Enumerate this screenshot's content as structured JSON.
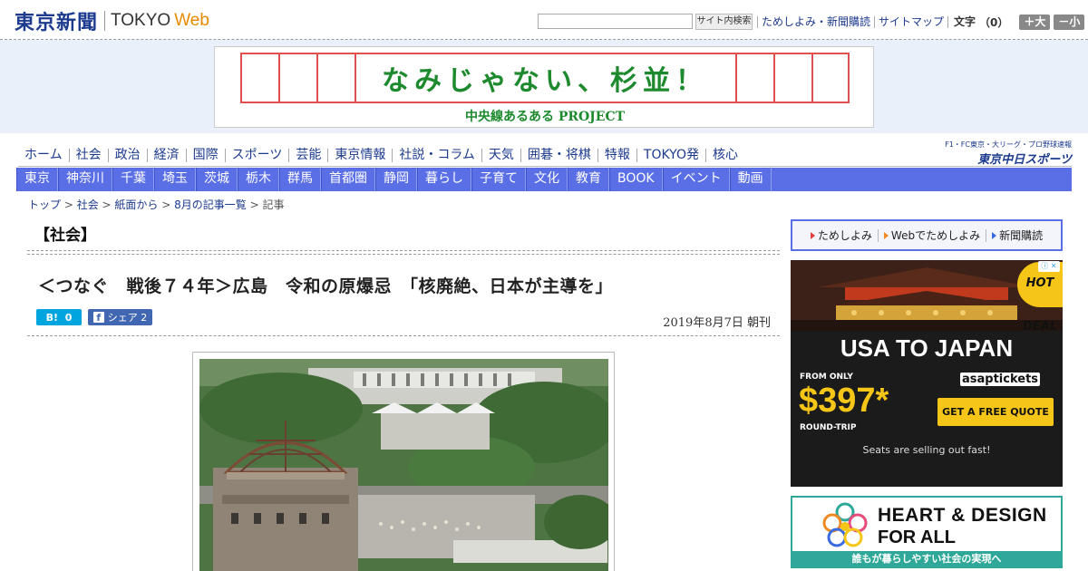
{
  "header": {
    "logo_jp": "東京新聞",
    "logo_en": "TOKYO",
    "logo_web": "Web",
    "search_placeholder": "",
    "search_button": "サイト内検索",
    "links": [
      "ためしよみ・新聞購読",
      "サイトマップ"
    ],
    "font_label": "文字",
    "font_count": "（0）",
    "font_larger": "＋大",
    "font_smaller": "－小"
  },
  "banner": {
    "title": "なみじゃない、杉並！",
    "subtitle": "中央線あるある PROJECT"
  },
  "nav_main": [
    "ホーム",
    "社会",
    "政治",
    "経済",
    "国際",
    "スポーツ",
    "芸能",
    "東京情報",
    "社説・コラム",
    "天気",
    "囲碁・将棋",
    "特報",
    "TOKYO発",
    "核心"
  ],
  "chunichi": {
    "small": "F1・FC東京・大リーグ・プロ野球速報",
    "big": "東京中日スポーツ"
  },
  "nav_sub": [
    "東京",
    "神奈川",
    "千葉",
    "埼玉",
    "茨城",
    "栃木",
    "群馬",
    "首都圏",
    "静岡",
    "暮らし",
    "子育て",
    "文化",
    "教育",
    "BOOK",
    "イベント",
    "動画"
  ],
  "breadcrumb": {
    "items": [
      "トップ",
      "社会",
      "紙面から",
      "8月の記事一覧"
    ],
    "separator": " > ",
    "current": "記事"
  },
  "article": {
    "section": "【社会】",
    "headline": "＜つなぐ　戦後７４年＞広島　令和の原爆忌　「核廃絶、日本が主導を」",
    "hatena_label": "B!",
    "hatena_count": "0",
    "fb_label": "シェア",
    "fb_count": "2",
    "date": "2019年8月7日 朝刊"
  },
  "sidebar": {
    "links": [
      "ためしよみ",
      "Webでためしよみ",
      "新聞購読"
    ]
  },
  "ad1": {
    "deal": "HOT DEAL",
    "headline": "USA TO JAPAN",
    "from_label": "FROM ONLY",
    "price": "$397*",
    "round_trip": "ROUND-TRIP",
    "brand": "asaptickets",
    "cta": "GET A FREE QUOTE",
    "tagline": "Seats are selling out fast!"
  },
  "ad2": {
    "line1": "HEART & DESIGN",
    "line2": "FOR ALL",
    "strip": "誰もが暮らしやすい社会の実現へ"
  }
}
